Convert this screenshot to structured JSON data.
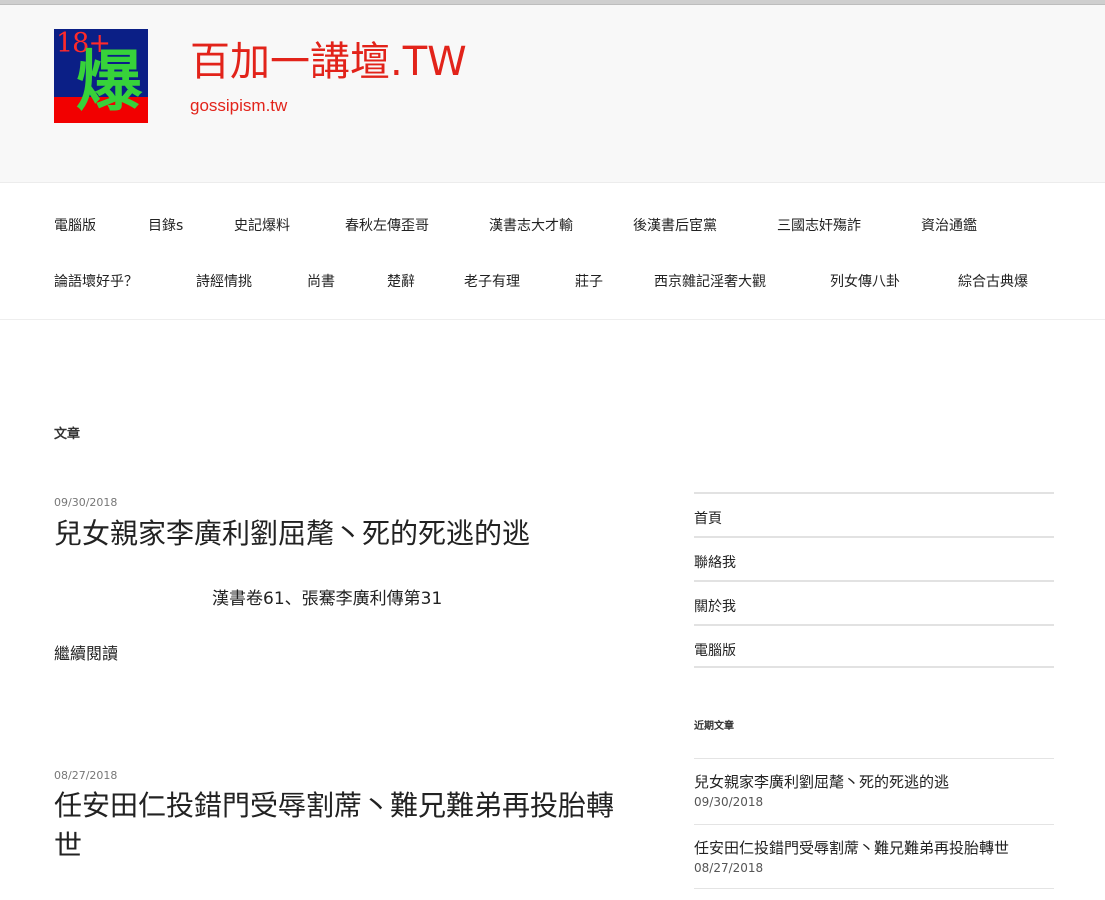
{
  "site": {
    "logo_number": "18+",
    "logo_char": "爆",
    "title": "百加一講壇.TW",
    "tagline": "gossipism.tw"
  },
  "nav": {
    "row1": [
      "電腦版",
      "目錄s",
      "史記爆料",
      "春秋左傳歪哥",
      "漢書志大才輸",
      "後漢書后宦黨",
      "三國志奸殤詐",
      "資治通鑑"
    ],
    "row2": [
      "論語壞好乎？",
      "詩經情挑",
      "尚書",
      "楚辭",
      "老子有理",
      "莊子",
      "西京雜記淫奢大觀",
      "列女傳八卦",
      "綜合古典爆"
    ]
  },
  "main": {
    "section_label": "文章",
    "posts": [
      {
        "date": "09/30/2018",
        "title": "兒女親家李廣利劉屈氂丶死的死逃的逃",
        "excerpt": "漢書卷61、張騫李廣利傳第31",
        "read_more": "繼續閱讀"
      },
      {
        "date": "08/27/2018",
        "title": "任安田仁投錯門受辱割蓆丶難兄難弟再投胎轉世"
      }
    ]
  },
  "sidebar": {
    "links": [
      "首頁",
      "聯絡我",
      "關於我",
      "電腦版"
    ],
    "recent_title": "近期文章",
    "recent": [
      {
        "title": "兒女親家李廣利劉屈氂丶死的死逃的逃",
        "date": "09/30/2018"
      },
      {
        "title": "任安田仁投錯門受辱割蓆丶難兄難弟再投胎轉世",
        "date": "08/27/2018"
      }
    ]
  },
  "colors": {
    "brand_red": "#e2231a",
    "logo_blue": "#0b1f86",
    "logo_green": "#37d23a"
  }
}
